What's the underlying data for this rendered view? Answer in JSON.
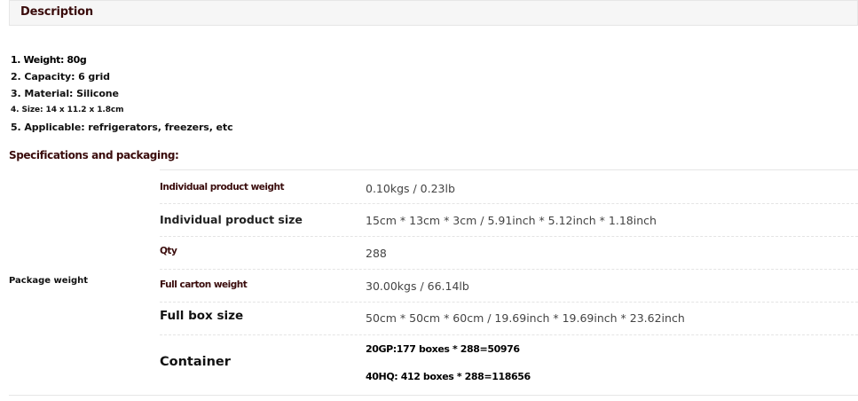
{
  "description": {
    "title": "Description"
  },
  "features": [
    "1. Weight: 80g",
    "2. Capacity: 6 grid",
    "3. Material: Silicone",
    "4. Size: 14 x 11.2 x 1.8cm",
    "5. Applicable: refrigerators, freezers, etc"
  ],
  "specs": {
    "heading": "Specifications and packaging:",
    "group_label": "Package weight",
    "rows": [
      {
        "key": "Individual product weight",
        "value": "0.10kgs / 0.23lb"
      },
      {
        "key": "Individual product size",
        "value": "15cm * 13cm * 3cm / 5.91inch * 5.12inch * 1.18inch"
      },
      {
        "key": "Qty",
        "value": "288"
      },
      {
        "key": "Full carton weight",
        "value": "30.00kgs / 66.14lb"
      },
      {
        "key": "Full box size",
        "value": "50cm * 50cm * 60cm / 19.69inch * 19.69inch * 23.62inch"
      },
      {
        "key": "Container",
        "values": [
          "20GP:177 boxes * 288=50976",
          "40HQ: 412 boxes * 288=118656"
        ]
      }
    ]
  }
}
